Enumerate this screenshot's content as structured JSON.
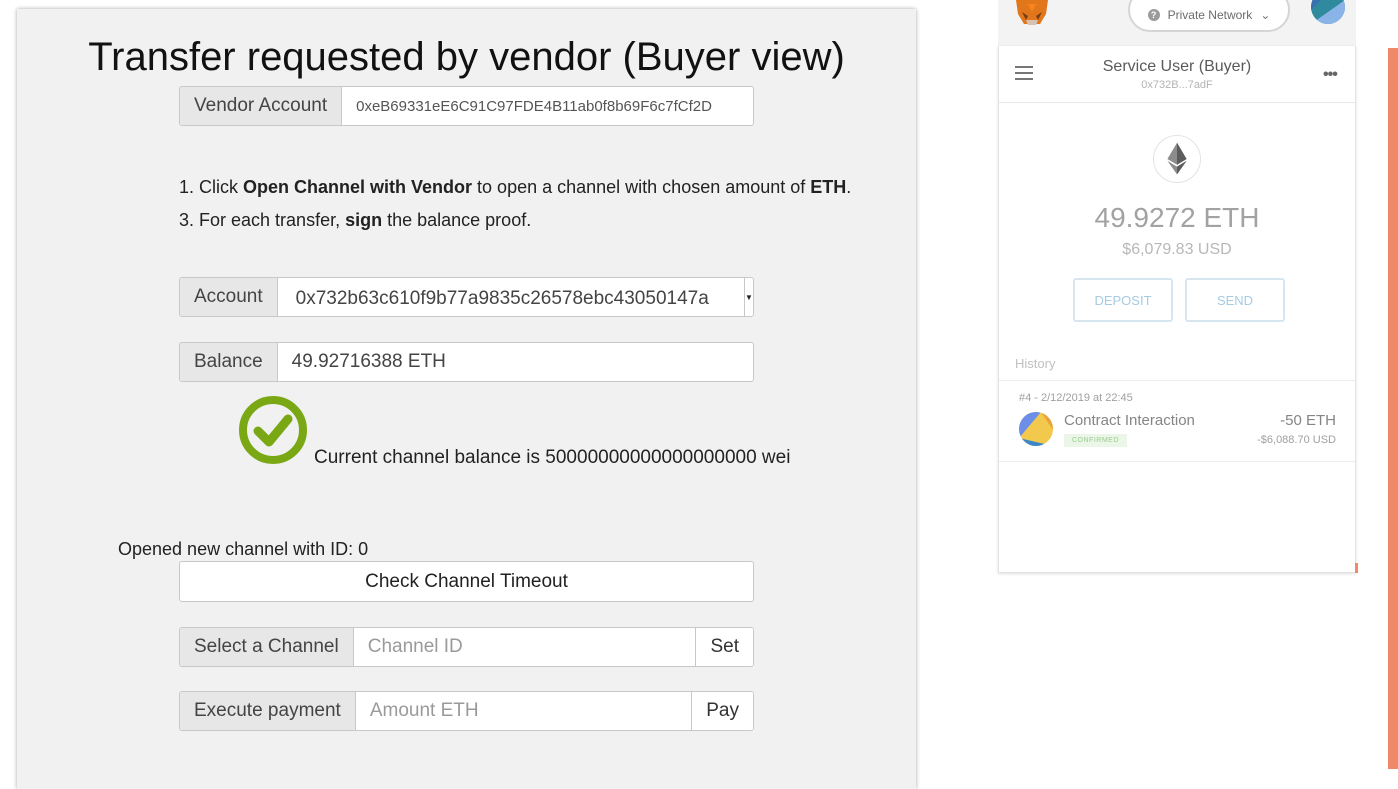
{
  "dapp": {
    "title": "Transfer requested by vendor (Buyer view)",
    "vendor_account": {
      "label": "Vendor Account",
      "value": "0xeB69331eE6C91C97FDE4B11ab0f8b69F6c7fCf2D"
    },
    "instructions": [
      {
        "prefix": "1. Click ",
        "bold": "Open Channel with Vendor",
        "middle": " to open a channel with chosen amount of ",
        "bold2": "ETH",
        "suffix": "."
      },
      {
        "prefix": "3. For each transfer, ",
        "bold": "sign",
        "suffix": " the balance proof."
      }
    ],
    "account": {
      "label": "Account",
      "value": "0x732b63c610f9b77a9835c26578ebc43050147a"
    },
    "balance": {
      "label": "Balance",
      "value": "49.92716388 ETH"
    },
    "channel_balance_text": "Current channel balance is 50000000000000000000 wei",
    "opened_text": "Opened new channel with ID: 0",
    "check_timeout_label": "Check Channel Timeout",
    "select_channel": {
      "label": "Select a Channel",
      "placeholder": "Channel ID",
      "button": "Set"
    },
    "execute_payment": {
      "label": "Execute payment",
      "placeholder": "Amount ETH",
      "button": "Pay"
    }
  },
  "metamask": {
    "network": "Private Network",
    "account_name": "Service User (Buyer)",
    "account_address": "0x732B...7adF",
    "eth_balance": "49.9272 ETH",
    "usd_balance": "$6,079.83 USD",
    "deposit_label": "DEPOSIT",
    "send_label": "SEND",
    "history_label": "History",
    "transactions": [
      {
        "date": "#4 - 2/12/2019 at 22:45",
        "title": "Contract Interaction",
        "status": "CONFIRMED",
        "amount": "-50 ETH",
        "usd": "-$6,088.70 USD"
      }
    ]
  },
  "colors": {
    "accent_orange": "#f0896a",
    "check_green": "#7aa815",
    "mm_button_blue": "#a6cbe3"
  }
}
